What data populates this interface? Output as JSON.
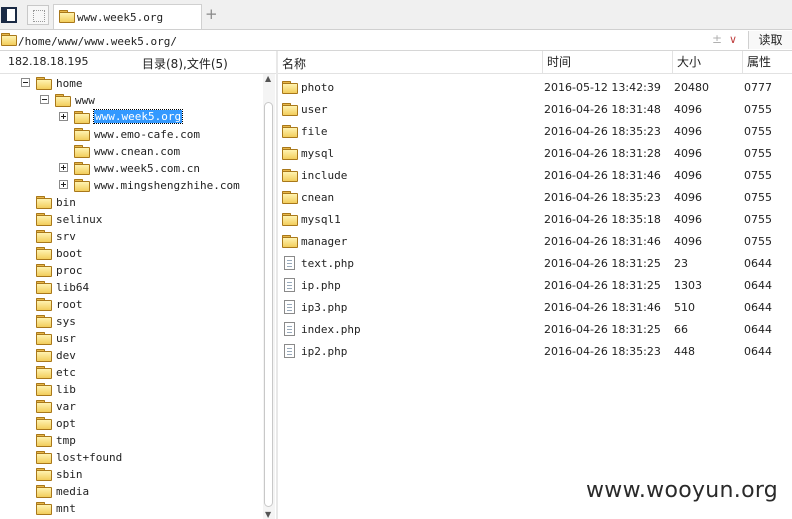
{
  "tabbar": {
    "tab_title": "www.week5.org",
    "add_tab": "+"
  },
  "pathbar": {
    "path": "/home/www/www.week5.org/",
    "control": "±",
    "dropdown": "∨",
    "read_button": "读取"
  },
  "left_header": {
    "ip": "182.18.18.195",
    "counts": "目录(8),文件(5)"
  },
  "columns": {
    "name": "名称",
    "time": "时间",
    "size": "大小",
    "perm": "属性"
  },
  "tree": [
    {
      "label": "home",
      "expander": "minus"
    },
    {
      "label": "www",
      "expander": "minus"
    },
    {
      "label": "www.week5.org",
      "expander": "plus",
      "selected": true
    },
    {
      "label": "www.emo-cafe.com",
      "expander": "none"
    },
    {
      "label": "www.cnean.com",
      "expander": "none"
    },
    {
      "label": "www.week5.com.cn",
      "expander": "plus"
    },
    {
      "label": "www.mingshengzhihe.com",
      "expander": "plus"
    },
    {
      "label": "bin"
    },
    {
      "label": "selinux"
    },
    {
      "label": "srv"
    },
    {
      "label": "boot"
    },
    {
      "label": "proc"
    },
    {
      "label": "lib64"
    },
    {
      "label": "root"
    },
    {
      "label": "sys"
    },
    {
      "label": "usr"
    },
    {
      "label": "dev"
    },
    {
      "label": "etc"
    },
    {
      "label": "lib"
    },
    {
      "label": "var"
    },
    {
      "label": "opt"
    },
    {
      "label": "tmp"
    },
    {
      "label": "lost+found"
    },
    {
      "label": "sbin"
    },
    {
      "label": "media"
    },
    {
      "label": "mnt"
    }
  ],
  "files": [
    {
      "name": "photo",
      "type": "folder",
      "time": "2016-05-12 13:42:39",
      "size": "20480",
      "perm": "0777"
    },
    {
      "name": "user",
      "type": "folder",
      "time": "2016-04-26 18:31:48",
      "size": "4096",
      "perm": "0755"
    },
    {
      "name": "file",
      "type": "folder",
      "time": "2016-04-26 18:35:23",
      "size": "4096",
      "perm": "0755"
    },
    {
      "name": "mysql",
      "type": "folder",
      "time": "2016-04-26 18:31:28",
      "size": "4096",
      "perm": "0755"
    },
    {
      "name": "include",
      "type": "folder",
      "time": "2016-04-26 18:31:46",
      "size": "4096",
      "perm": "0755"
    },
    {
      "name": "cnean",
      "type": "folder",
      "time": "2016-04-26 18:35:23",
      "size": "4096",
      "perm": "0755"
    },
    {
      "name": "mysql1",
      "type": "folder",
      "time": "2016-04-26 18:35:18",
      "size": "4096",
      "perm": "0755"
    },
    {
      "name": "manager",
      "type": "folder",
      "time": "2016-04-26 18:31:46",
      "size": "4096",
      "perm": "0755"
    },
    {
      "name": "text.php",
      "type": "file",
      "time": "2016-04-26 18:31:25",
      "size": "23",
      "perm": "0644"
    },
    {
      "name": "ip.php",
      "type": "file",
      "time": "2016-04-26 18:31:25",
      "size": "1303",
      "perm": "0644"
    },
    {
      "name": "ip3.php",
      "type": "file",
      "time": "2016-04-26 18:31:46",
      "size": "510",
      "perm": "0644"
    },
    {
      "name": "index.php",
      "type": "file",
      "time": "2016-04-26 18:31:25",
      "size": "66",
      "perm": "0644"
    },
    {
      "name": "ip2.php",
      "type": "file",
      "time": "2016-04-26 18:35:23",
      "size": "448",
      "perm": "0644"
    }
  ],
  "watermark": "www.wooyun.org"
}
